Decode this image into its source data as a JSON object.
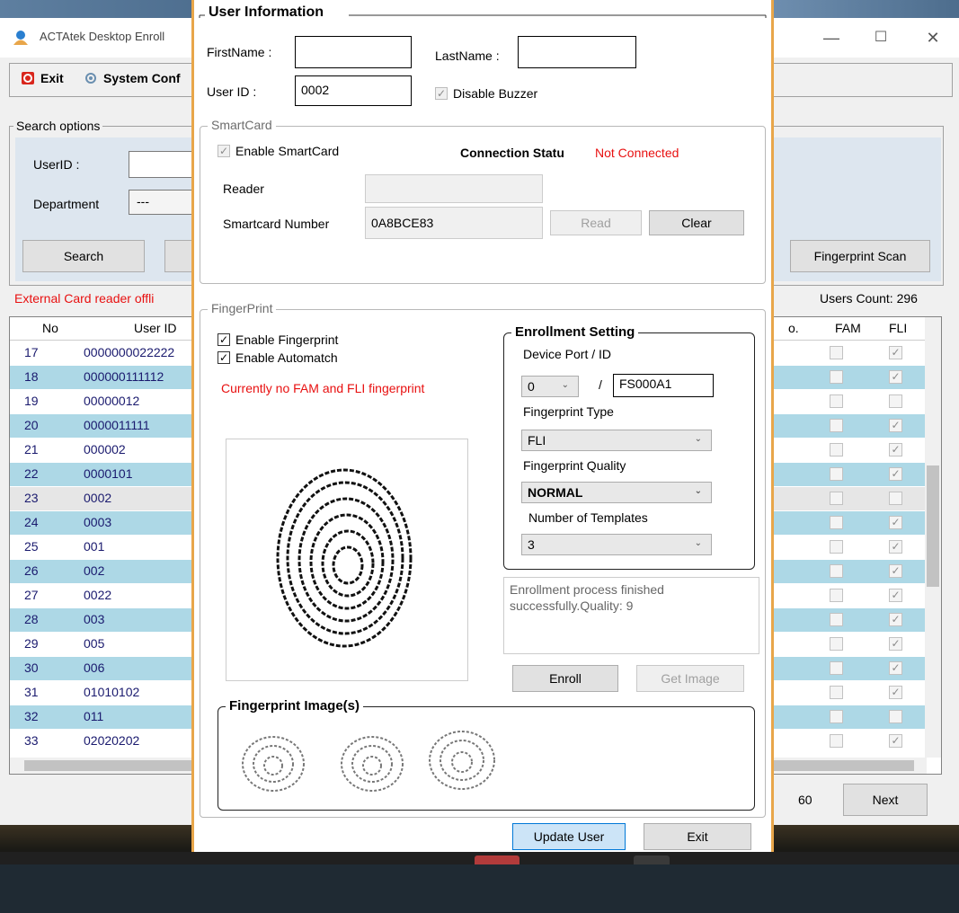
{
  "window": {
    "title": "ACTAtek Desktop Enroll"
  },
  "menu": {
    "exit_label": "Exit",
    "system_conf_label": "System Conf"
  },
  "search": {
    "group_label": "Search options",
    "userid_label": "UserID :",
    "department_label": "Department",
    "department_value": "---",
    "search_button": "Search",
    "fingerprint_scan_button": "Fingerprint Scan"
  },
  "status": {
    "card_reader": "External Card reader offli",
    "users_count": "Users Count: 296"
  },
  "grid": {
    "col_no": "No",
    "col_userid": "User ID",
    "col_o": "o.",
    "col_fam": "FAM",
    "col_fli": "FLI",
    "rows": [
      {
        "no": "17",
        "uid": "0000000022222",
        "fli": "✓"
      },
      {
        "no": "18",
        "uid": "000000111112",
        "fli": "✓"
      },
      {
        "no": "19",
        "uid": "00000012",
        "fli": ""
      },
      {
        "no": "20",
        "uid": "0000011111",
        "fli": "✓"
      },
      {
        "no": "21",
        "uid": "000002",
        "fli": "✓"
      },
      {
        "no": "22",
        "uid": "0000101",
        "fli": "✓"
      },
      {
        "no": "23",
        "uid": "0002",
        "fli": ""
      },
      {
        "no": "24",
        "uid": "0003",
        "fli": "✓"
      },
      {
        "no": "25",
        "uid": "001",
        "fli": "✓"
      },
      {
        "no": "26",
        "uid": "002",
        "fli": "✓"
      },
      {
        "no": "27",
        "uid": "0022",
        "fli": "✓"
      },
      {
        "no": "28",
        "uid": "003",
        "fli": "✓"
      },
      {
        "no": "29",
        "uid": "005",
        "fli": "✓"
      },
      {
        "no": "30",
        "uid": "006",
        "fli": "✓"
      },
      {
        "no": "31",
        "uid": "01010102",
        "fli": "✓"
      },
      {
        "no": "32",
        "uid": "011",
        "fli": ""
      },
      {
        "no": "33",
        "uid": "02020202",
        "fli": "✓"
      }
    ]
  },
  "pager": {
    "page_count": "60",
    "next_button": "Next"
  },
  "dialog": {
    "user_info_legend": "User Information",
    "firstname_label": "FirstName :",
    "firstname_value": "",
    "lastname_label": "LastName :",
    "lastname_value": "",
    "userid_label": "User ID :",
    "userid_value": "0002",
    "disable_buzzer": "Disable Buzzer",
    "smartcard": {
      "legend": "SmartCard",
      "enable_label": "Enable SmartCard",
      "connection_label": "Connection Statu",
      "connection_value": "Not Connected",
      "reader_label": "Reader",
      "reader_value": "",
      "number_label": "Smartcard Number",
      "number_value": "0A8BCE83",
      "read_button": "Read",
      "clear_button": "Clear"
    },
    "fingerprint": {
      "legend": "FingerPrint",
      "enable_fp": "Enable Fingerprint",
      "enable_automatch": "Enable Automatch",
      "warning": "Currently no FAM and FLI fingerprint",
      "enroll_setting_legend": "Enrollment Setting",
      "device_port_label": "Device Port / ID",
      "port_value": "0",
      "slash": "/",
      "device_id_value": "FS000A1",
      "type_label": "Fingerprint Type",
      "type_value": "FLI",
      "quality_label": "Fingerprint Quality",
      "quality_value": "NORMAL",
      "templates_label": "Number of Templates",
      "templates_value": "3",
      "status_message": "Enrollment process finished successfully.Quality: 9",
      "enroll_button": "Enroll",
      "get_image_button": "Get Image",
      "images_legend": "Fingerprint Image(s)"
    },
    "update_button": "Update User",
    "exit_button": "Exit"
  },
  "colors": {
    "error_red": "#e81010",
    "row_alt": "#add8e6",
    "row_text": "#1a1a6e",
    "dialog_border": "#e8a64a"
  }
}
